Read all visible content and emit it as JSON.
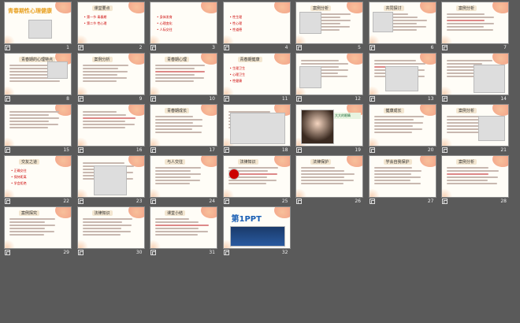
{
  "slides": [
    {
      "n": "1",
      "title": "青春期性心理健康"
    },
    {
      "n": "2",
      "title": "课堂要点",
      "items": [
        "第一节 青春期",
        "第二节 性心理"
      ]
    },
    {
      "n": "3",
      "items": [
        "身体发育",
        "心理变化",
        "人际交往"
      ]
    },
    {
      "n": "4",
      "items": [
        "性生理",
        "性心理",
        "性道德"
      ]
    },
    {
      "n": "5",
      "title": "案例分析"
    },
    {
      "n": "6",
      "title": "共同探讨"
    },
    {
      "n": "7",
      "title": "案例分析"
    },
    {
      "n": "8",
      "title": "青春期的心理特点"
    },
    {
      "n": "9",
      "title": "案例分析"
    },
    {
      "n": "10",
      "title": "青春期心理"
    },
    {
      "n": "11",
      "title": "青春期健康",
      "items": [
        "生理卫生",
        "心理卫生",
        "性健康"
      ]
    },
    {
      "n": "12"
    },
    {
      "n": "13"
    },
    {
      "n": "14"
    },
    {
      "n": "15"
    },
    {
      "n": "16"
    },
    {
      "n": "17",
      "title": "青春期成长"
    },
    {
      "n": "18"
    },
    {
      "n": "19",
      "caption": "大大的眼睛"
    },
    {
      "n": "20",
      "title": "健康成长"
    },
    {
      "n": "21",
      "title": "案例分析"
    },
    {
      "n": "22",
      "title": "交友之道",
      "items": [
        "正确交往",
        "保持距离",
        "学会拒绝"
      ]
    },
    {
      "n": "23"
    },
    {
      "n": "24",
      "title": "与人交往"
    },
    {
      "n": "25",
      "title": "法律知识"
    },
    {
      "n": "26",
      "title": "法律保护"
    },
    {
      "n": "27",
      "title": "学会自我保护"
    },
    {
      "n": "28",
      "title": "案例分析"
    },
    {
      "n": "29",
      "title": "案例探究"
    },
    {
      "n": "30",
      "title": "法律知识"
    },
    {
      "n": "31",
      "title": "课堂小结"
    },
    {
      "n": "32",
      "title": "第1PPT"
    }
  ],
  "colors": {
    "background": "#5a5a5a",
    "slide": "#fffdf7",
    "accent_red": "#cc0000",
    "orange": "#f29a7a"
  }
}
